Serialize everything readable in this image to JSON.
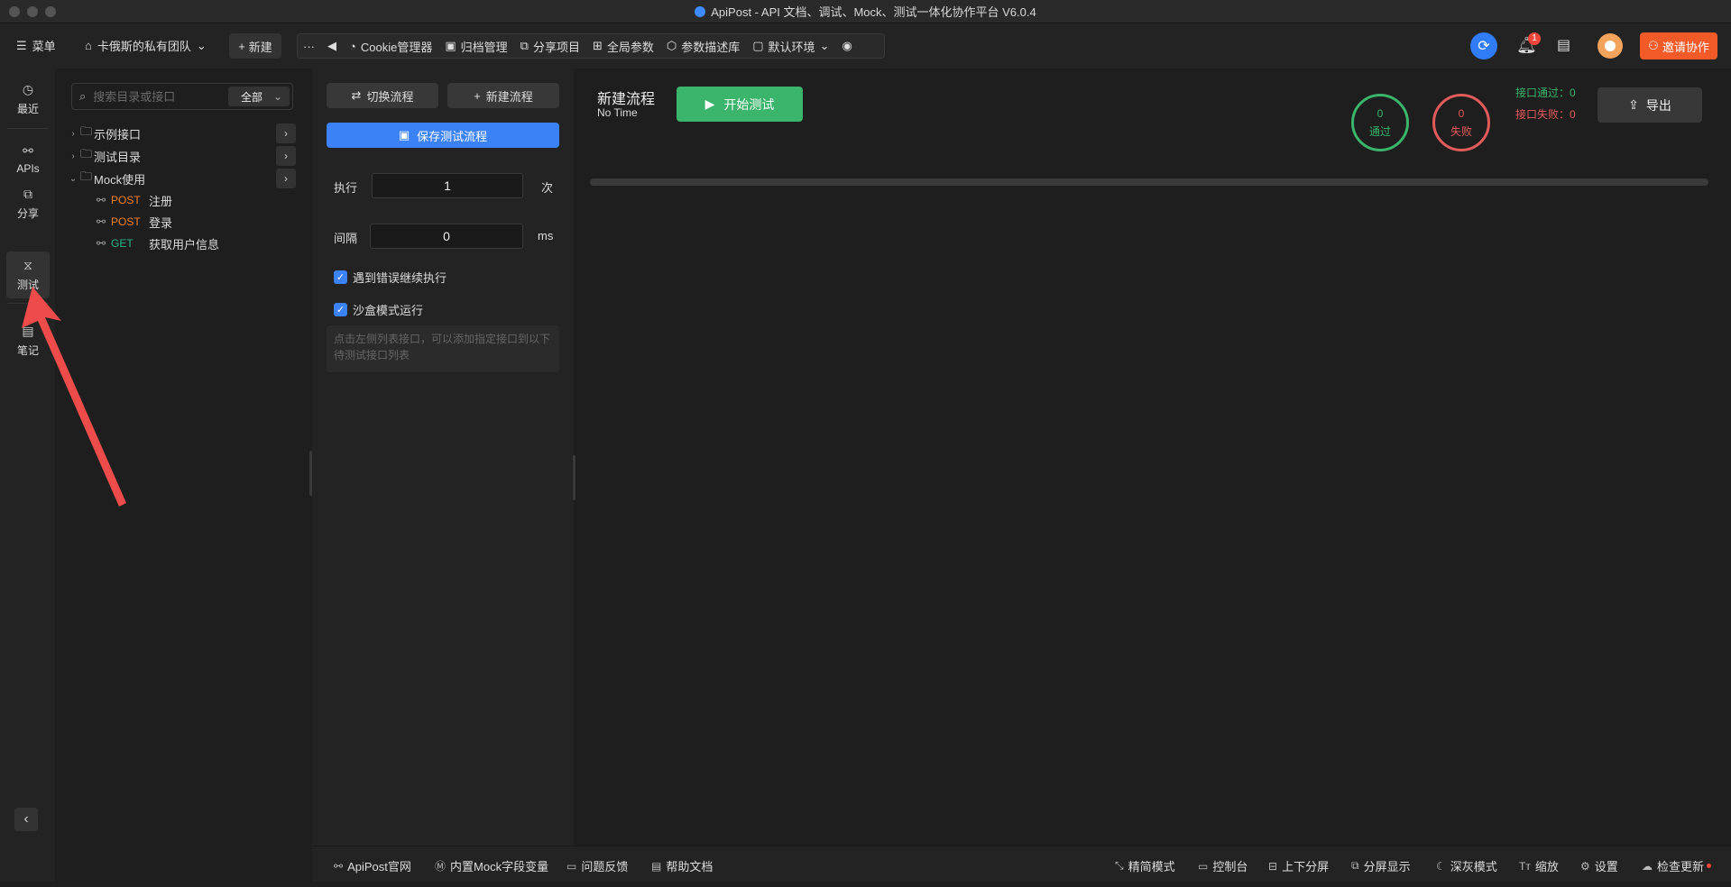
{
  "window": {
    "title": "ApiPost - API 文档、调试、Mock、测试一体化协作平台 V6.0.4"
  },
  "toolbar": {
    "menu_label": "菜单",
    "team_label": "卡俄斯的私有团队",
    "new_label": "新建",
    "more_label": "···",
    "items": [
      "Cookie管理器",
      "归档管理",
      "分享项目",
      "全局参数",
      "参数描述库",
      "默认环境"
    ],
    "notification_count": "1",
    "invite_label": "邀请协作"
  },
  "rail": {
    "items": [
      {
        "label": "最近",
        "icon": "clock-icon"
      },
      {
        "label": "APIs",
        "icon": "link-icon"
      },
      {
        "label": "分享",
        "icon": "share-icon"
      },
      {
        "label": "测试",
        "icon": "flow-icon"
      },
      {
        "label": "笔记",
        "icon": "note-icon"
      }
    ],
    "active": "测试"
  },
  "tree": {
    "search_placeholder": "搜索目录或接口",
    "filter_value": "全部",
    "folders": [
      {
        "name": "示例接口",
        "expanded": false
      },
      {
        "name": "测试目录",
        "expanded": false
      },
      {
        "name": "Mock使用",
        "expanded": true
      }
    ],
    "apis": [
      {
        "method": "POST",
        "name": "注册"
      },
      {
        "method": "POST",
        "name": "登录"
      },
      {
        "method": "GET",
        "name": "获取用户信息"
      }
    ]
  },
  "flow": {
    "switch_label": "切换流程",
    "new_label": "新建流程",
    "save_label": "保存测试流程",
    "exec_label": "执行",
    "exec_value": "1",
    "exec_unit": "次",
    "interval_label": "间隔",
    "interval_value": "0",
    "interval_unit": "ms",
    "continue_on_error_label": "遇到错误继续执行",
    "sandbox_label": "沙盒模式运行",
    "hint": "点击左侧列表接口，可以添加指定接口到以下待测试接口列表"
  },
  "main": {
    "title": "新建流程",
    "time": "No Time",
    "start_label": "开始测试",
    "pass_count": "0",
    "pass_label": "通过",
    "fail_count": "0",
    "fail_label": "失败",
    "api_pass": "接口通过：0",
    "api_fail": "接口失败：0",
    "export_label": "导出",
    "progress": 0
  },
  "statusbar": {
    "left": [
      "ApiPost官网",
      "内置Mock字段变量",
      "问题反馈",
      "帮助文档"
    ],
    "right": [
      "精简模式",
      "控制台",
      "上下分屏",
      "分屏显示",
      "深灰模式",
      "缩放",
      "设置",
      "检查更新"
    ]
  },
  "colors": {
    "accent_blue": "#3b82f6",
    "pass_green": "#3ab56b",
    "fail_red": "#e35b5b",
    "invite_orange": "#f25a28",
    "post_orange": "#f5822a",
    "get_green": "#2bb38a"
  }
}
